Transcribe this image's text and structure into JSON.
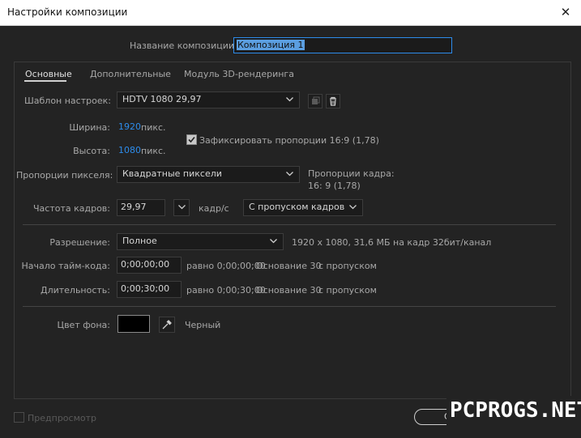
{
  "window": {
    "title": "Настройки композиции",
    "close_icon": "close-icon"
  },
  "composition_name": {
    "label": "Название композиции:",
    "value": "Композиция 1"
  },
  "tabs": [
    {
      "label": "Основные",
      "active": true
    },
    {
      "label": "Дополнительные",
      "active": false
    },
    {
      "label": "Модуль 3D-рендеринга",
      "active": false
    }
  ],
  "preset": {
    "label": "Шаблон настроек:",
    "value": "HDTV 1080 29,97",
    "save_icon": "save-preset-icon",
    "delete_icon": "trash-icon"
  },
  "width": {
    "label": "Ширина:",
    "value": "1920",
    "unit": "пикс."
  },
  "height": {
    "label": "Высота:",
    "value": "1080",
    "unit": "пикс."
  },
  "lock_aspect": {
    "label": "Зафиксировать пропорции 16:9 (1,78)",
    "checked": true
  },
  "pixel_aspect": {
    "label": "Пропорции пикселя:",
    "value": "Квадратные пиксели",
    "frame_aspect_label": "Пропорции кадра:",
    "frame_aspect_value": "16: 9 (1,78)"
  },
  "frame_rate": {
    "label": "Частота кадров:",
    "value": "29,97",
    "unit": "кадр/с",
    "drop_frame": "С пропуском кадров"
  },
  "resolution": {
    "label": "Разрешение:",
    "value": "Полное",
    "info": "1920 x 1080, 31,6 МБ на кадр 32бит/канал"
  },
  "start_timecode": {
    "label": "Начало тайм-кода:",
    "value": "0;00;00;00",
    "equals": "равно 0;00;00;00",
    "base": "Основание 30",
    "drop": "с пропуском"
  },
  "duration": {
    "label": "Длительность:",
    "value": "0;00;30;00",
    "equals": "равно 0;00;30;00",
    "base": "Основание 30",
    "drop": "с пропуском"
  },
  "background_color": {
    "label": "Цвет фона:",
    "color": "#000000",
    "name": "Черный",
    "eyedropper_icon": "eyedropper-icon"
  },
  "preview": {
    "label": "Предпросмотр",
    "checked": false
  },
  "ok_button": {
    "label": "OK"
  },
  "watermark": {
    "text": "PCPROGS.NET"
  },
  "colors": {
    "accent": "#2d8ceb",
    "background": "#232323",
    "titlebar": "#ffffff"
  }
}
